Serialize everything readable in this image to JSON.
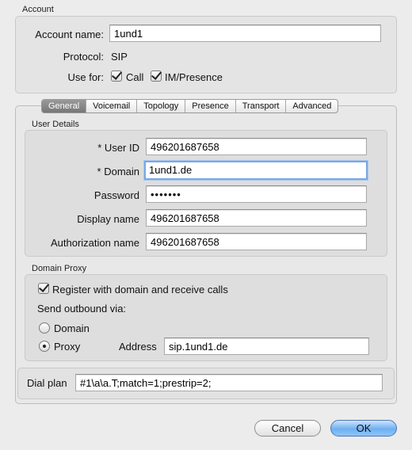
{
  "account": {
    "section_title": "Account",
    "name_label": "Account name:",
    "name_value": "1und1",
    "protocol_label": "Protocol:",
    "protocol_value": "SIP",
    "use_for_label": "Use for:",
    "call_label": "Call",
    "call_checked": true,
    "im_label": "IM/Presence",
    "im_checked": true
  },
  "tabs": [
    {
      "label": "General",
      "active": true
    },
    {
      "label": "Voicemail",
      "active": false
    },
    {
      "label": "Topology",
      "active": false
    },
    {
      "label": "Presence",
      "active": false
    },
    {
      "label": "Transport",
      "active": false
    },
    {
      "label": "Advanced",
      "active": false
    }
  ],
  "user_details": {
    "section_title": "User Details",
    "user_id_label": "* User ID",
    "user_id_value": "496201687658",
    "domain_label": "* Domain",
    "domain_value": "1und1.de",
    "password_label": "Password",
    "password_value": "•••••••",
    "display_name_label": "Display name",
    "display_name_value": "496201687658",
    "auth_name_label": "Authorization name",
    "auth_name_value": "496201687658"
  },
  "domain_proxy": {
    "section_title": "Domain Proxy",
    "register_label": "Register with domain and receive calls",
    "register_checked": true,
    "send_outbound_label": "Send outbound via:",
    "domain_option_label": "Domain",
    "proxy_option_label": "Proxy",
    "selected": "Proxy",
    "address_label": "Address",
    "address_value": "sip.1und1.de"
  },
  "dial_plan": {
    "label": "Dial plan",
    "value": "#1\\a\\a.T;match=1;prestrip=2;"
  },
  "buttons": {
    "cancel": "Cancel",
    "ok": "OK"
  }
}
